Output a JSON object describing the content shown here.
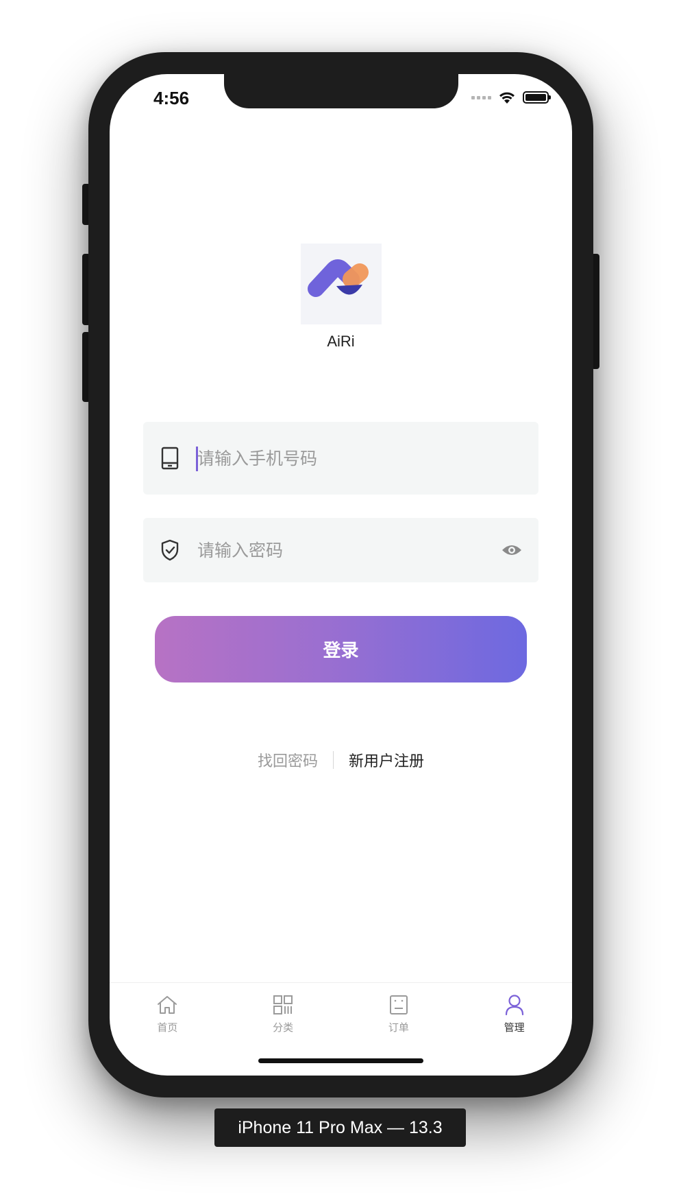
{
  "status_bar": {
    "time": "4:56"
  },
  "app": {
    "name": "AiRi",
    "logo_icon": "airi-logo-icon"
  },
  "form": {
    "phone": {
      "placeholder": "请输入手机号码",
      "value": "",
      "icon": "phone-icon"
    },
    "password": {
      "placeholder": "请输入密码",
      "value": "",
      "icon": "shield-icon",
      "toggle_icon": "eye-icon"
    },
    "login_label": "登录"
  },
  "links": {
    "forgot_password": "找回密码",
    "register": "新用户注册"
  },
  "tabbar": {
    "tabs": [
      {
        "label": "首页",
        "icon": "home-icon",
        "active": false
      },
      {
        "label": "分类",
        "icon": "grid-icon",
        "active": false
      },
      {
        "label": "订单",
        "icon": "order-icon",
        "active": false
      },
      {
        "label": "管理",
        "icon": "user-icon",
        "active": true
      }
    ]
  },
  "simulator_caption": "iPhone 11 Pro Max — 13.3",
  "colors": {
    "accent": "#7b61d8",
    "gradient_start": "#b772c4",
    "gradient_end": "#6d69e0",
    "logo_orange": "#f0975a",
    "field_background": "#f4f6f6"
  }
}
